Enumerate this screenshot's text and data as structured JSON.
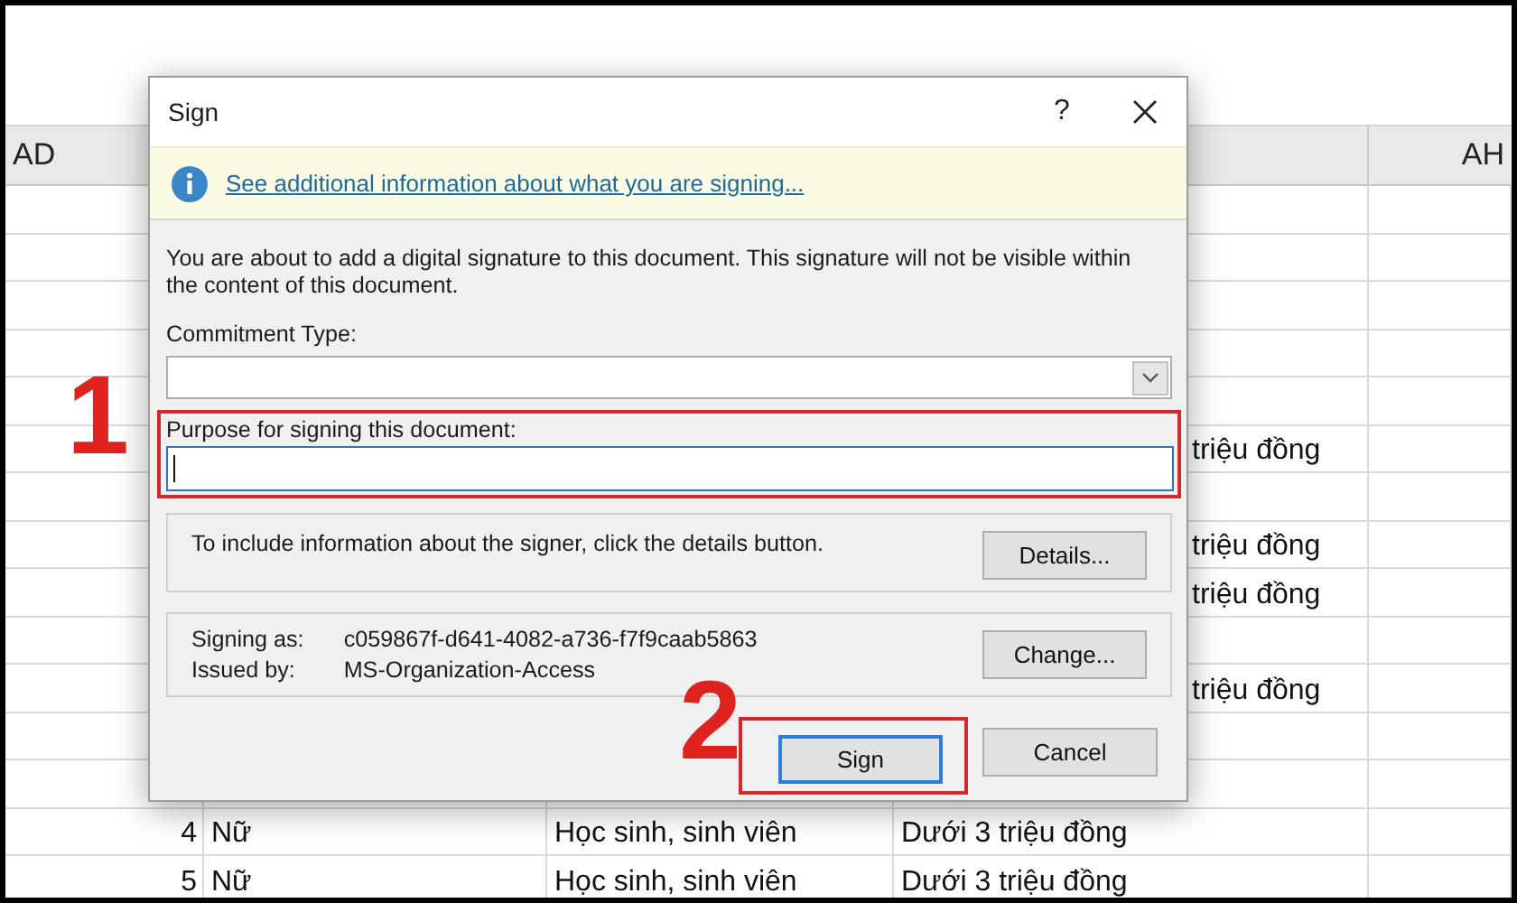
{
  "spreadsheet": {
    "column_headers": [
      {
        "label": "AD"
      },
      {
        "label": "AH"
      }
    ],
    "rows": [
      {},
      {},
      {},
      {},
      {},
      {
        "column_d": "triệu đồng"
      },
      {},
      {
        "column_d": "triệu đồng"
      },
      {
        "column_d": "triệu đồng"
      },
      {},
      {
        "column_d": "triệu đồng"
      },
      {},
      {},
      {
        "number": "4",
        "column_b": "Nữ",
        "column_c": "Học sinh, sinh viên",
        "column_d": "Dưới 3 triệu đồng"
      },
      {
        "number": "5",
        "column_b": "Nữ",
        "column_c": "Học sinh, sinh viên",
        "column_d": "Dưới 3 triệu đồng"
      }
    ]
  },
  "dialog": {
    "title": "Sign",
    "help_button": "?",
    "info_link": "See additional information about what you are signing...",
    "description": "You are about to add a digital signature to this document. This signature will not be visible within the content of this document.",
    "commitment_type": {
      "label": "Commitment Type:"
    },
    "purpose": {
      "label": "Purpose for signing this document:",
      "focused": true
    },
    "signer_details": {
      "text": "To include information about the signer, click the details button.",
      "button": "Details..."
    },
    "signing_info": {
      "rows": [
        {
          "label": "Signing as:",
          "value": "c059867f-d641-4082-a736-f7f9caab5863"
        },
        {
          "label": "Issued by:",
          "value": "MS-Organization-Access"
        }
      ],
      "button": "Change..."
    },
    "buttons": [
      {
        "label": "Sign",
        "default": true
      },
      {
        "label": "Cancel",
        "default": false
      }
    ]
  },
  "annotations": [
    {
      "label": "1"
    },
    {
      "label": "2"
    }
  ]
}
